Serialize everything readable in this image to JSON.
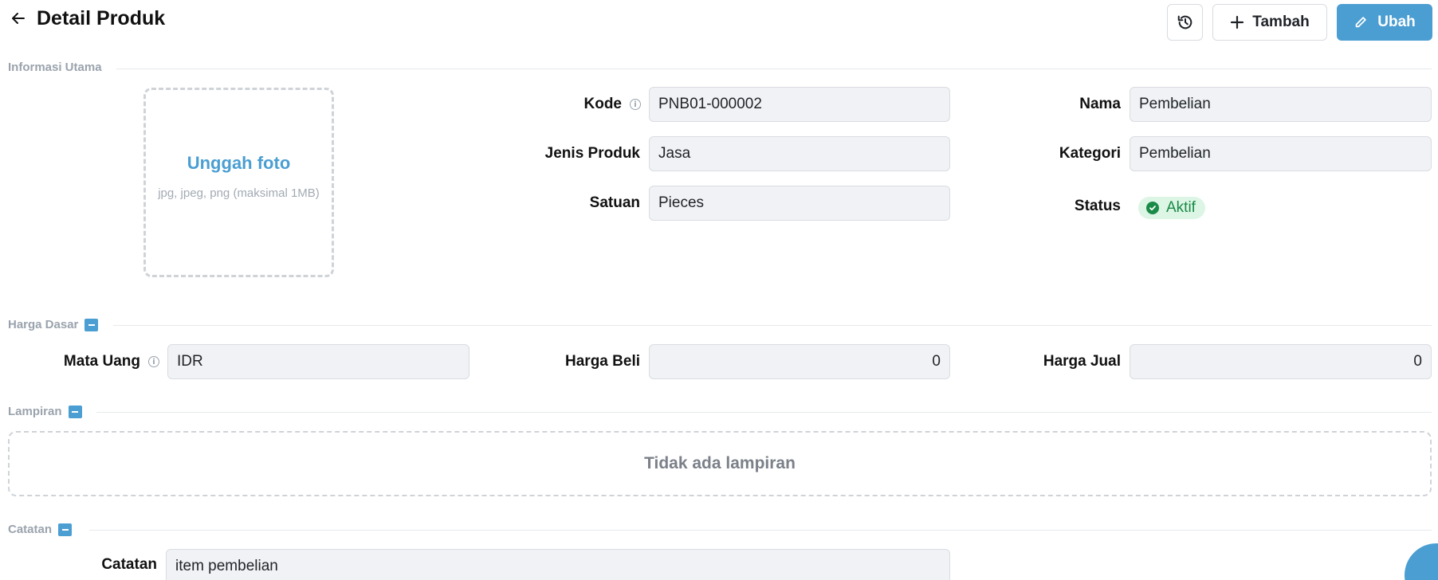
{
  "header": {
    "title": "Detail Produk",
    "add_label": "Tambah",
    "edit_label": "Ubah"
  },
  "sections": {
    "main_info": "Informasi Utama",
    "base_price": "Harga Dasar",
    "attachments": "Lampiran",
    "notes": "Catatan"
  },
  "upload": {
    "title": "Unggah foto",
    "hint": "jpg, jpeg, png (maksimal 1MB)"
  },
  "fields": {
    "code_label": "Kode",
    "code_value": "PNB01-000002",
    "type_label": "Jenis Produk",
    "type_value": "Jasa",
    "unit_label": "Satuan",
    "unit_value": "Pieces",
    "name_label": "Nama",
    "name_value": "Pembelian",
    "category_label": "Kategori",
    "category_value": "Pembelian",
    "status_label": "Status",
    "status_value": "Aktif"
  },
  "pricing": {
    "currency_label": "Mata Uang",
    "currency_value": "IDR",
    "buy_label": "Harga Beli",
    "buy_value": "0",
    "sell_label": "Harga Jual",
    "sell_value": "0"
  },
  "attachments": {
    "empty_text": "Tidak ada lampiran"
  },
  "notes": {
    "label": "Catatan",
    "value": "item pembelian"
  },
  "colors": {
    "accent": "#4b9ed2",
    "status_green": "#1a8a47",
    "status_bg": "#dcf5e4"
  },
  "icons": [
    "back-arrow-icon",
    "history-icon",
    "plus-icon",
    "pencil-icon",
    "info-icon",
    "check-circle-icon",
    "collapse-icon"
  ]
}
